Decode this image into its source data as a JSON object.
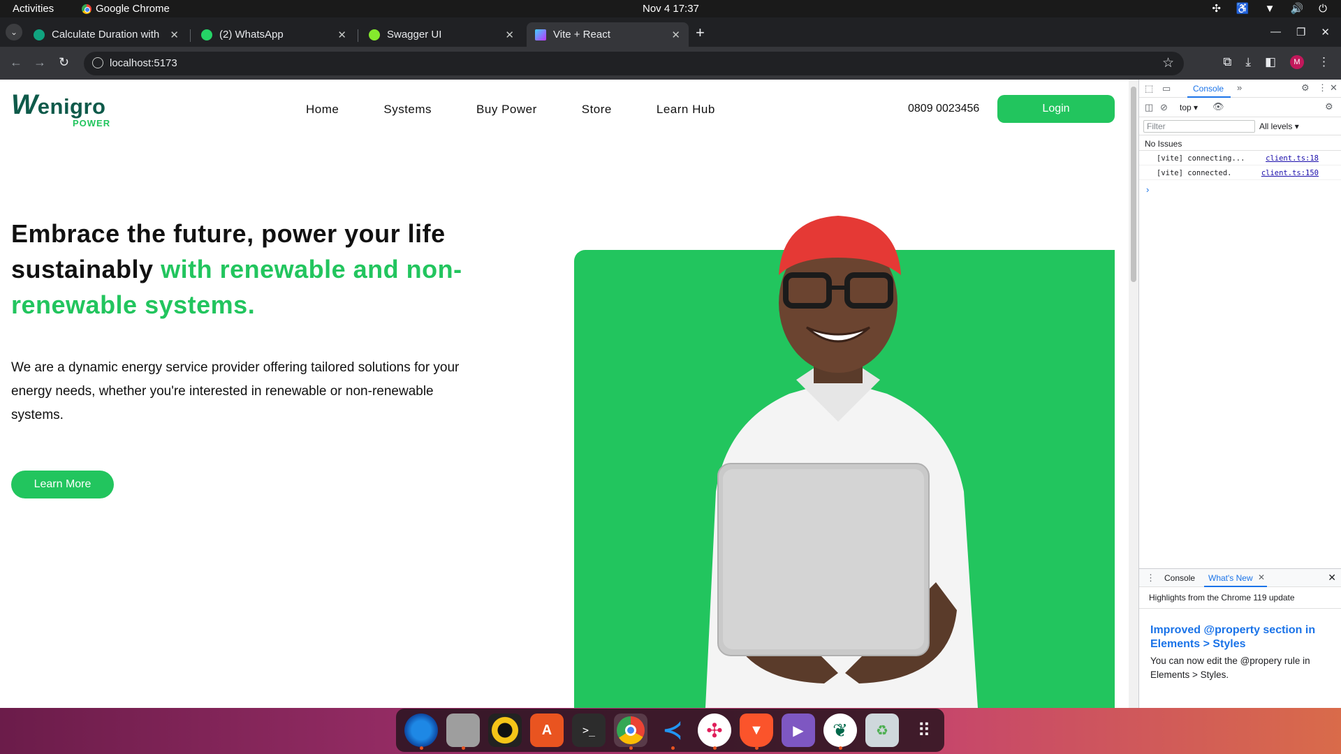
{
  "system": {
    "activities": "Activities",
    "app_name": "Google Chrome",
    "clock": "Nov 4  17:37"
  },
  "tabs": [
    {
      "title": "Calculate Duration with",
      "color": "#10a37f"
    },
    {
      "title": "(2) WhatsApp",
      "color": "#25d366"
    },
    {
      "title": "Swagger UI",
      "color": "#85ea2d"
    },
    {
      "title": "Vite + React",
      "color": "#a855f7",
      "active": true
    }
  ],
  "omnibox": {
    "url": "localhost:5173"
  },
  "profile_initial": "M",
  "site": {
    "logo": {
      "w": "W",
      "rest": "enigro",
      "sub": "POWER"
    },
    "nav": [
      "Home",
      "Systems",
      "Buy Power",
      "Store",
      "Learn Hub"
    ],
    "phone": "0809 0023456",
    "login": "Login",
    "hero_title_a": "Embrace the future, power your life sustainably ",
    "hero_title_b": "with renewable and non-renewable systems.",
    "hero_text": "We are a dynamic energy service provider offering tailored solutions for your energy needs, whether you're interested in renewable or non-renewable systems.",
    "learn_more": "Learn More",
    "accent": "#22c55e"
  },
  "devtools": {
    "console_tab": "Console",
    "context": "top",
    "filter_placeholder": "Filter",
    "levels": "All levels",
    "no_issues": "No Issues",
    "logs": [
      {
        "msg": "[vite] connecting...",
        "src": "client.ts:18"
      },
      {
        "msg": "[vite] connected.",
        "src": "client.ts:150"
      }
    ],
    "drawer_console": "Console",
    "drawer_whats_new": "What's New",
    "highlights": "Highlights from the Chrome 119 update",
    "wn_title": "Improved @property section in Elements > Styles",
    "wn_desc": "You can now edit the @propery rule in Elements > Styles."
  }
}
